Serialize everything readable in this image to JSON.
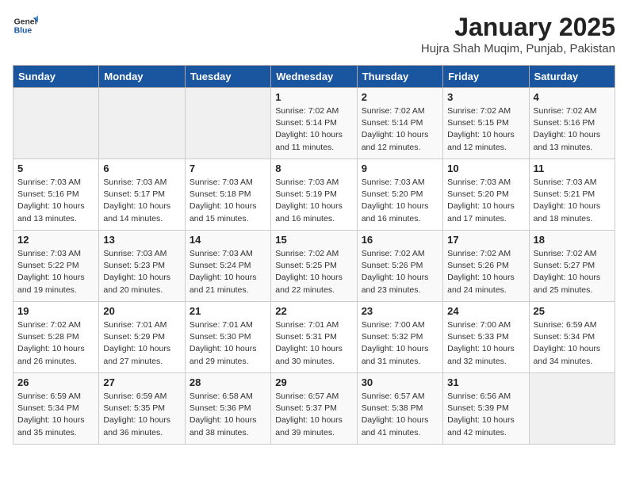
{
  "header": {
    "logo_general": "General",
    "logo_blue": "Blue",
    "title": "January 2025",
    "subtitle": "Hujra Shah Muqim, Punjab, Pakistan"
  },
  "days_of_week": [
    "Sunday",
    "Monday",
    "Tuesday",
    "Wednesday",
    "Thursday",
    "Friday",
    "Saturday"
  ],
  "weeks": [
    [
      {
        "day": "",
        "info": ""
      },
      {
        "day": "",
        "info": ""
      },
      {
        "day": "",
        "info": ""
      },
      {
        "day": "1",
        "sunrise": "7:02 AM",
        "sunset": "5:14 PM",
        "daylight": "10 hours and 11 minutes."
      },
      {
        "day": "2",
        "sunrise": "7:02 AM",
        "sunset": "5:14 PM",
        "daylight": "10 hours and 12 minutes."
      },
      {
        "day": "3",
        "sunrise": "7:02 AM",
        "sunset": "5:15 PM",
        "daylight": "10 hours and 12 minutes."
      },
      {
        "day": "4",
        "sunrise": "7:02 AM",
        "sunset": "5:16 PM",
        "daylight": "10 hours and 13 minutes."
      }
    ],
    [
      {
        "day": "5",
        "sunrise": "7:03 AM",
        "sunset": "5:16 PM",
        "daylight": "10 hours and 13 minutes."
      },
      {
        "day": "6",
        "sunrise": "7:03 AM",
        "sunset": "5:17 PM",
        "daylight": "10 hours and 14 minutes."
      },
      {
        "day": "7",
        "sunrise": "7:03 AM",
        "sunset": "5:18 PM",
        "daylight": "10 hours and 15 minutes."
      },
      {
        "day": "8",
        "sunrise": "7:03 AM",
        "sunset": "5:19 PM",
        "daylight": "10 hours and 16 minutes."
      },
      {
        "day": "9",
        "sunrise": "7:03 AM",
        "sunset": "5:20 PM",
        "daylight": "10 hours and 16 minutes."
      },
      {
        "day": "10",
        "sunrise": "7:03 AM",
        "sunset": "5:20 PM",
        "daylight": "10 hours and 17 minutes."
      },
      {
        "day": "11",
        "sunrise": "7:03 AM",
        "sunset": "5:21 PM",
        "daylight": "10 hours and 18 minutes."
      }
    ],
    [
      {
        "day": "12",
        "sunrise": "7:03 AM",
        "sunset": "5:22 PM",
        "daylight": "10 hours and 19 minutes."
      },
      {
        "day": "13",
        "sunrise": "7:03 AM",
        "sunset": "5:23 PM",
        "daylight": "10 hours and 20 minutes."
      },
      {
        "day": "14",
        "sunrise": "7:03 AM",
        "sunset": "5:24 PM",
        "daylight": "10 hours and 21 minutes."
      },
      {
        "day": "15",
        "sunrise": "7:02 AM",
        "sunset": "5:25 PM",
        "daylight": "10 hours and 22 minutes."
      },
      {
        "day": "16",
        "sunrise": "7:02 AM",
        "sunset": "5:26 PM",
        "daylight": "10 hours and 23 minutes."
      },
      {
        "day": "17",
        "sunrise": "7:02 AM",
        "sunset": "5:26 PM",
        "daylight": "10 hours and 24 minutes."
      },
      {
        "day": "18",
        "sunrise": "7:02 AM",
        "sunset": "5:27 PM",
        "daylight": "10 hours and 25 minutes."
      }
    ],
    [
      {
        "day": "19",
        "sunrise": "7:02 AM",
        "sunset": "5:28 PM",
        "daylight": "10 hours and 26 minutes."
      },
      {
        "day": "20",
        "sunrise": "7:01 AM",
        "sunset": "5:29 PM",
        "daylight": "10 hours and 27 minutes."
      },
      {
        "day": "21",
        "sunrise": "7:01 AM",
        "sunset": "5:30 PM",
        "daylight": "10 hours and 29 minutes."
      },
      {
        "day": "22",
        "sunrise": "7:01 AM",
        "sunset": "5:31 PM",
        "daylight": "10 hours and 30 minutes."
      },
      {
        "day": "23",
        "sunrise": "7:00 AM",
        "sunset": "5:32 PM",
        "daylight": "10 hours and 31 minutes."
      },
      {
        "day": "24",
        "sunrise": "7:00 AM",
        "sunset": "5:33 PM",
        "daylight": "10 hours and 32 minutes."
      },
      {
        "day": "25",
        "sunrise": "6:59 AM",
        "sunset": "5:34 PM",
        "daylight": "10 hours and 34 minutes."
      }
    ],
    [
      {
        "day": "26",
        "sunrise": "6:59 AM",
        "sunset": "5:34 PM",
        "daylight": "10 hours and 35 minutes."
      },
      {
        "day": "27",
        "sunrise": "6:59 AM",
        "sunset": "5:35 PM",
        "daylight": "10 hours and 36 minutes."
      },
      {
        "day": "28",
        "sunrise": "6:58 AM",
        "sunset": "5:36 PM",
        "daylight": "10 hours and 38 minutes."
      },
      {
        "day": "29",
        "sunrise": "6:57 AM",
        "sunset": "5:37 PM",
        "daylight": "10 hours and 39 minutes."
      },
      {
        "day": "30",
        "sunrise": "6:57 AM",
        "sunset": "5:38 PM",
        "daylight": "10 hours and 41 minutes."
      },
      {
        "day": "31",
        "sunrise": "6:56 AM",
        "sunset": "5:39 PM",
        "daylight": "10 hours and 42 minutes."
      },
      {
        "day": "",
        "info": ""
      }
    ]
  ],
  "labels": {
    "sunrise_prefix": "Sunrise: ",
    "sunset_prefix": "Sunset: ",
    "daylight_prefix": "Daylight: "
  }
}
